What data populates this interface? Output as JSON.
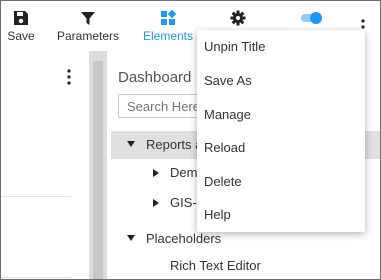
{
  "toolbar": {
    "save": {
      "label": "Save",
      "icon": "save-icon"
    },
    "parameters": {
      "label": "Parameters",
      "icon": "filter-icon"
    },
    "elements": {
      "label": "Elements",
      "icon": "elements-icon",
      "color": "#2196f3"
    },
    "settings": {
      "icon": "gear-icon"
    },
    "toggle": {
      "icon": "toggle-icon",
      "color": "#2196f3"
    },
    "more": {
      "icon": "kebab-icon"
    }
  },
  "right_panel": {
    "title": "Dashboard",
    "search_placeholder": "Search Here",
    "tree": {
      "reports_label": "Reports a",
      "demo_label": "Dem",
      "gis_label": "GIS-C",
      "placeholders_label": "Placeholders",
      "rich_text_label": "Rich Text Editor"
    }
  },
  "menu": {
    "items": [
      "Unpin Title",
      "Save As",
      "Manage",
      "Reload",
      "Delete",
      "Help"
    ]
  }
}
